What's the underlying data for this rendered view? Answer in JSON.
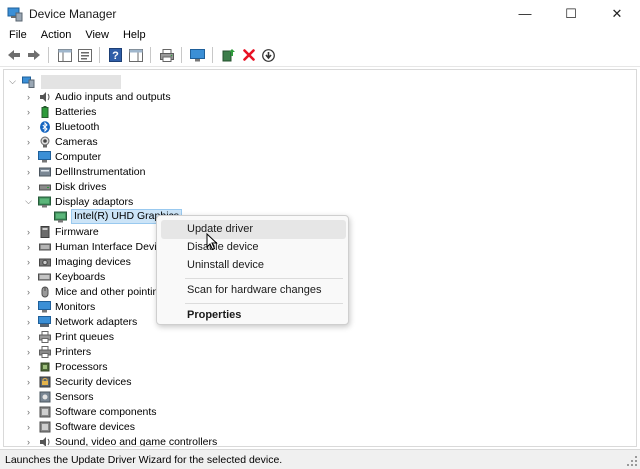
{
  "window": {
    "title": "Device Manager",
    "controls": {
      "minimize": "—",
      "maximize": "☐",
      "close": "✕"
    }
  },
  "menu": [
    "File",
    "Action",
    "View",
    "Help"
  ],
  "toolbar": {
    "buttons": [
      "back-icon",
      "forward-icon",
      "show-hide-console-tree-icon",
      "properties-icon",
      "help-icon",
      "action-pane-icon",
      "print-icon",
      "monitor-icon",
      "update-driver-icon",
      "uninstall-icon",
      "download-icon"
    ]
  },
  "tree": {
    "root_label": "",
    "categories": [
      {
        "label": "Audio inputs and outputs",
        "icon": "speaker-icon"
      },
      {
        "label": "Batteries",
        "icon": "battery-icon"
      },
      {
        "label": "Bluetooth",
        "icon": "bluetooth-icon"
      },
      {
        "label": "Cameras",
        "icon": "camera-icon"
      },
      {
        "label": "Computer",
        "icon": "computer-icon"
      },
      {
        "label": "DellInstrumentation",
        "icon": "dell-instrumentation-icon"
      },
      {
        "label": "Disk drives",
        "icon": "disk-drive-icon"
      },
      {
        "label": "Display adaptors",
        "icon": "display-adaptor-icon"
      },
      {
        "label": "Intel(R) UHD Graphics",
        "icon": "display-adaptor-icon"
      },
      {
        "label": "Firmware",
        "icon": "firmware-icon"
      },
      {
        "label": "Human Interface Device",
        "icon": "hid-icon"
      },
      {
        "label": "Imaging devices",
        "icon": "imaging-icon"
      },
      {
        "label": "Keyboards",
        "icon": "keyboard-icon"
      },
      {
        "label": "Mice and other pointin",
        "icon": "mouse-icon"
      },
      {
        "label": "Monitors",
        "icon": "monitor-icon"
      },
      {
        "label": "Network adapters",
        "icon": "network-adapter-icon"
      },
      {
        "label": "Print queues",
        "icon": "print-queue-icon"
      },
      {
        "label": "Printers",
        "icon": "printer-icon"
      },
      {
        "label": "Processors",
        "icon": "processor-icon"
      },
      {
        "label": "Security devices",
        "icon": "security-device-icon"
      },
      {
        "label": "Sensors",
        "icon": "sensor-icon"
      },
      {
        "label": "Software components",
        "icon": "software-component-icon"
      },
      {
        "label": "Software devices",
        "icon": "software-device-icon"
      },
      {
        "label": "Sound, video and game controllers",
        "icon": "sound-controller-icon"
      }
    ]
  },
  "context_menu": {
    "update_driver": "Update driver",
    "disable_device": "Disable device",
    "uninstall_device": "Uninstall device",
    "scan_hardware": "Scan for hardware changes",
    "properties": "Properties"
  },
  "status": "Launches the Update Driver Wizard for the selected device.",
  "colors": {
    "selection": "#cce4f7",
    "accent_blue": "#0078d4",
    "uninstall_red": "#e81123",
    "update_green": "#2e9b3b"
  }
}
